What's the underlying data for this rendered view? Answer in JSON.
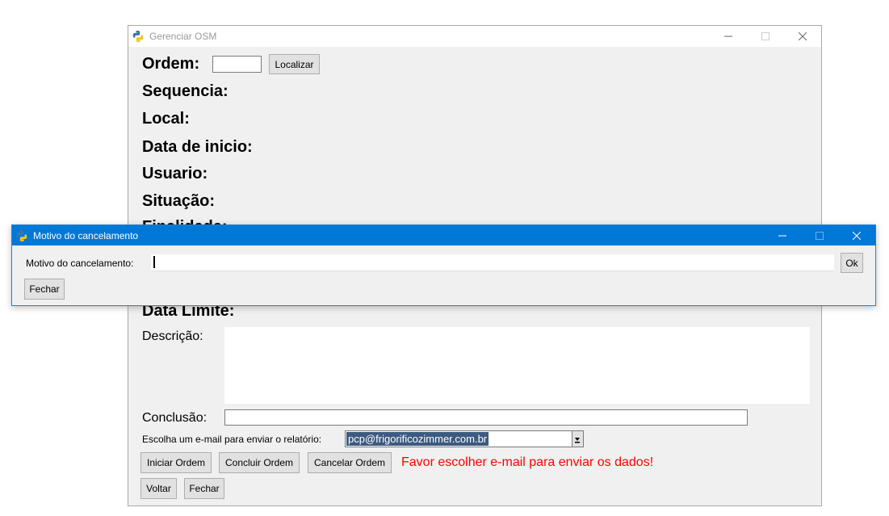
{
  "main_window": {
    "title": "Gerenciar OSM",
    "ordem_label": "Ordem:",
    "ordem_value": "",
    "localizar_button": "Localizar",
    "sequencia_label": "Sequencia:",
    "local_label": "Local:",
    "data_inicio_label": "Data de inicio:",
    "usuario_label": "Usuario:",
    "situacao_label": "Situação:",
    "finalidade_label_partial": "Finalidade:",
    "data_limite_label": "Data Limite:",
    "descricao_label": "Descrição:",
    "conclusao_label": "Conclusão:",
    "email_label": "Escolha um e-mail para enviar o relatório:",
    "email_selected": "pcp@frigorificozimmer.com.br",
    "iniciar_button": "Iniciar Ordem",
    "concluir_button": "Concluir Ordem",
    "cancelar_button": "Cancelar Ordem",
    "warning_text": "Favor escolher e-mail para enviar os dados!",
    "voltar_button": "Voltar",
    "fechar_button": "Fechar"
  },
  "dialog": {
    "title": "Motivo do cancelamento",
    "motivo_label": "Motivo do cancelamento:",
    "motivo_value": "",
    "ok_button": "Ok",
    "fechar_button": "Fechar"
  },
  "colors": {
    "dialog_titlebar": "#0078d7",
    "window_bg": "#f0f0f0",
    "warning": "#ff0000",
    "selection": "#3d5a80"
  }
}
